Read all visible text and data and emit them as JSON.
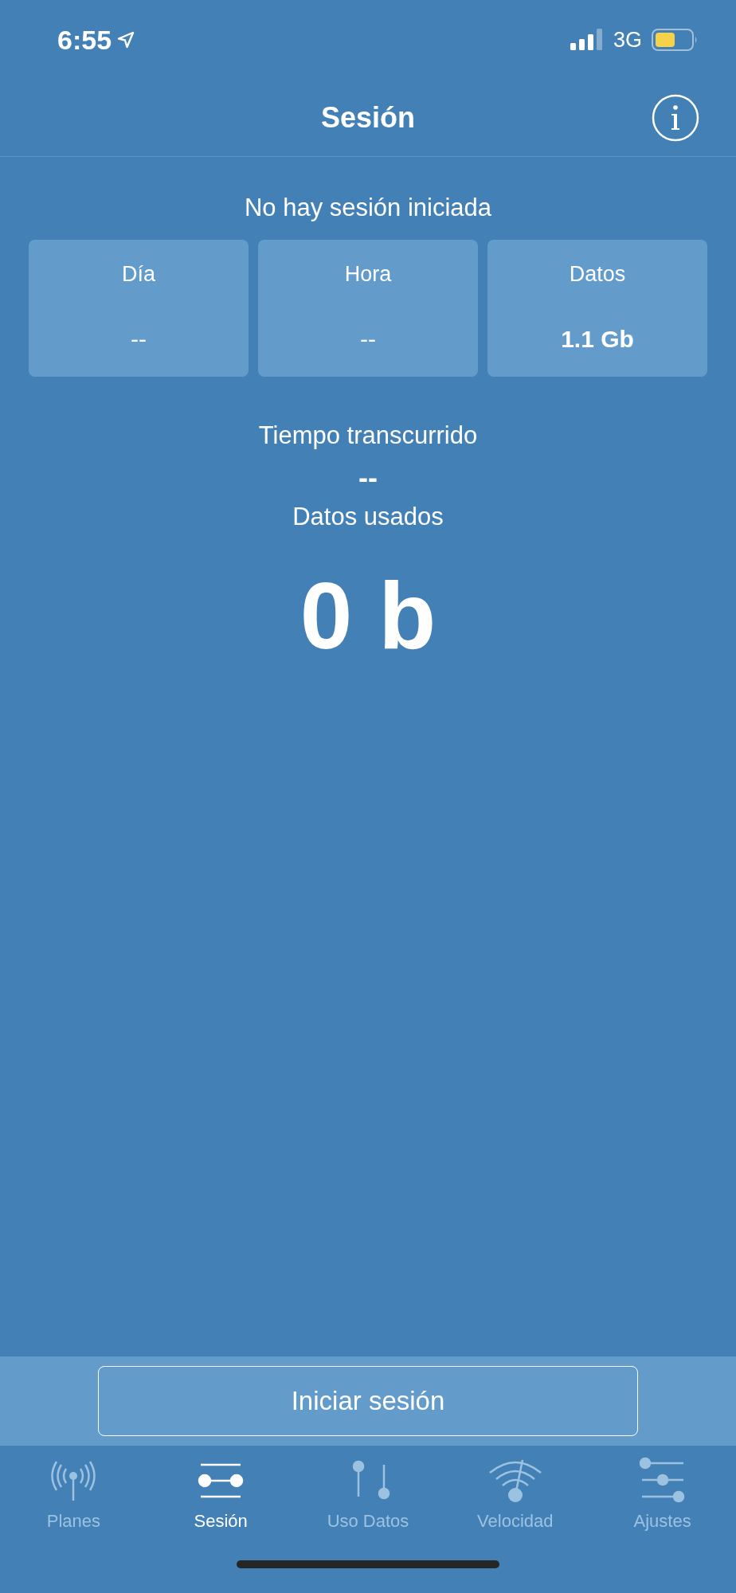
{
  "status_bar": {
    "time": "6:55",
    "network": "3G"
  },
  "nav_bar": {
    "title": "Sesión"
  },
  "session": {
    "status": "No hay sesión iniciada",
    "cards": [
      {
        "label": "Día",
        "value": "--",
        "emphasis": false
      },
      {
        "label": "Hora",
        "value": "--",
        "emphasis": false
      },
      {
        "label": "Datos",
        "value": "1.1 Gb",
        "emphasis": true
      }
    ],
    "elapsed_label": "Tiempo transcurrido",
    "elapsed_value": "--",
    "used_label": "Datos usados",
    "used_value": "0 b"
  },
  "action_button": "Iniciar sesión",
  "tabs": [
    {
      "label": "Planes",
      "kind": "antenna",
      "selected": false
    },
    {
      "label": "Sesión",
      "kind": "session",
      "selected": true
    },
    {
      "label": "Uso Datos",
      "kind": "usage",
      "selected": false
    },
    {
      "label": "Velocidad",
      "kind": "speed",
      "selected": false
    },
    {
      "label": "Ajustes",
      "kind": "settings",
      "selected": false
    }
  ]
}
